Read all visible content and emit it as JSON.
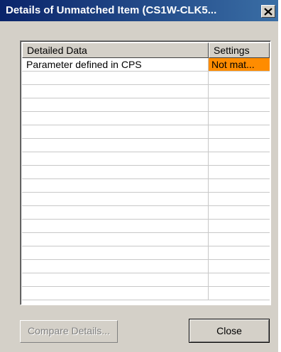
{
  "window": {
    "title": "Details of Unmatched Item (CS1W-CLK5..."
  },
  "grid": {
    "columns": [
      "Detailed Data",
      "Settings"
    ],
    "rows": [
      {
        "detail": "Parameter defined in CPS",
        "settings": "Not mat...",
        "status_color": "#ff8c00"
      }
    ]
  },
  "buttons": {
    "compare_label": "Compare Details...",
    "close_label": "Close"
  },
  "colors": {
    "titlebar": "#0a246a",
    "dialog_face": "#d4d0c8",
    "unmatched": "#ff8c00"
  }
}
